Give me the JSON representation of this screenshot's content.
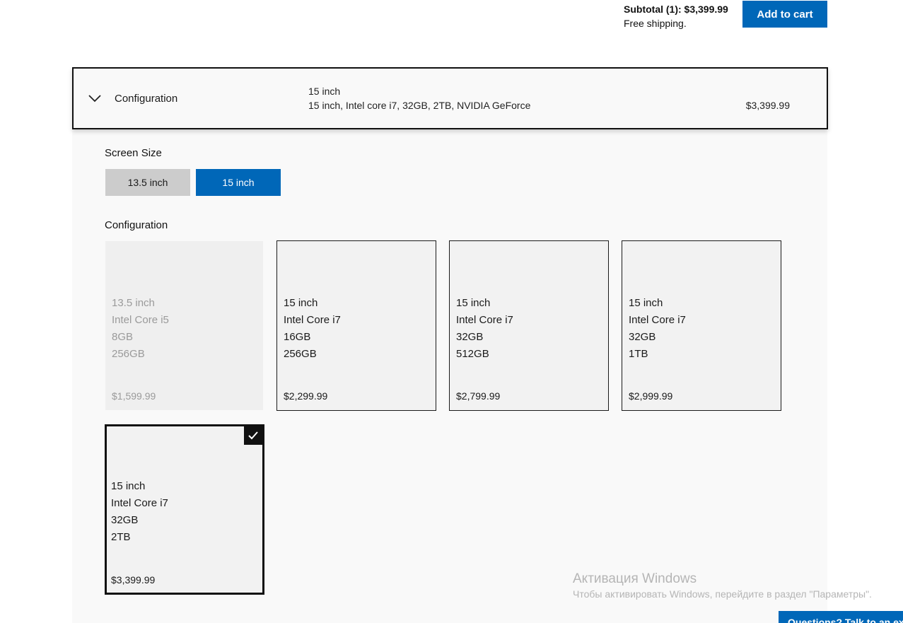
{
  "cart": {
    "subtotal": "Subtotal (1): $3,399.99",
    "shipping": "Free shipping.",
    "add_to_cart": "Add to cart"
  },
  "accordion": {
    "title": "Configuration",
    "summary_size": "15 inch",
    "summary_details": "15 inch, Intel core i7, 32GB, 2TB, NVIDIA GeForce",
    "price": "$3,399.99",
    "icon": "chevron-down-icon"
  },
  "screen_size": {
    "label": "Screen Size",
    "options": [
      {
        "label": "13.5 inch",
        "selected": false
      },
      {
        "label": "15 inch",
        "selected": true
      }
    ]
  },
  "configuration": {
    "label": "Configuration",
    "cards": [
      {
        "size": "13.5 inch",
        "cpu": "Intel Core i5",
        "ram": "8GB",
        "storage": "256GB",
        "price": "$1,599.99",
        "state": "disabled"
      },
      {
        "size": "15 inch",
        "cpu": "Intel Core i7",
        "ram": "16GB",
        "storage": "256GB",
        "price": "$2,299.99",
        "state": "available"
      },
      {
        "size": "15 inch",
        "cpu": "Intel Core i7",
        "ram": "32GB",
        "storage": "512GB",
        "price": "$2,799.99",
        "state": "available"
      },
      {
        "size": "15 inch",
        "cpu": "Intel Core i7",
        "ram": "32GB",
        "storage": "1TB",
        "price": "$2,999.99",
        "state": "available"
      },
      {
        "size": "15 inch",
        "cpu": "Intel Core i7",
        "ram": "32GB",
        "storage": "2TB",
        "price": "$3,399.99",
        "state": "selected"
      }
    ]
  },
  "watermark": {
    "title": "Активация Windows",
    "subtitle": "Чтобы активировать Windows, перейдите в раздел \"Параметры\"."
  },
  "help_tab": {
    "label": "Questions? Talk to an expert"
  },
  "colors": {
    "accent": "#0067b8",
    "selected_border": "#111111",
    "panel_bg": "#f9f9f9",
    "disabled_text": "#9a9a9a"
  }
}
